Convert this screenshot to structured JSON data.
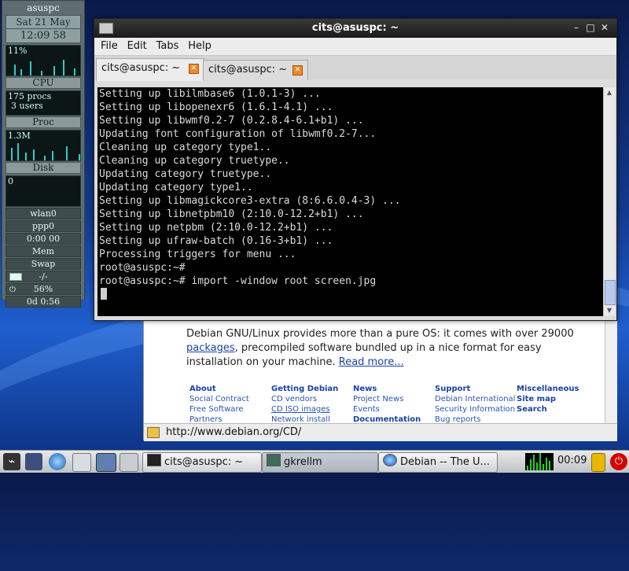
{
  "gkrellm": {
    "hostname": "asuspc",
    "date": "Sat 21 May",
    "time": "12:09 58",
    "cpu_percent_label": "11%",
    "cpu_label": "CPU",
    "procs": "175 procs",
    "users": "3 users",
    "proc_label": "Proc",
    "disk_rate": "1.3M",
    "disk_label": "Disk",
    "net_value": "0",
    "wlan_label": "wlan0",
    "ppp_label": "ppp0",
    "ppp_timer": "0:00 00",
    "mem_label": "Mem",
    "swap_label": "Swap",
    "mail_value": "-/-",
    "battery_value": "56%",
    "uptime": "0d 0:56"
  },
  "terminal": {
    "title": "cits@asuspc: ~",
    "menu": [
      "File",
      "Edit",
      "Tabs",
      "Help"
    ],
    "tabs": [
      {
        "label": "cits@asuspc: ~",
        "active": true
      },
      {
        "label": "cits@asuspc: ~",
        "active": false
      }
    ],
    "lines": [
      "Setting up libilmbase6 (1.0.1-3) ...",
      "Setting up libopenexr6 (1.6.1-4.1) ...",
      "Setting up libwmf0.2-7 (0.2.8.4-6.1+b1) ...",
      "Updating font configuration of libwmf0.2-7...",
      "Cleaning up category type1..",
      "Cleaning up category truetype..",
      "Updating category truetype..",
      "Updating category type1..",
      "Setting up libmagickcore3-extra (8:6.6.0.4-3) ...",
      "Setting up libnetpbm10 (2:10.0-12.2+b1) ...",
      "Setting up netpbm (2:10.0-12.2+b1) ...",
      "Setting up ufraw-batch (0.16-3+b1) ...",
      "Processing triggers for menu ...",
      "root@asuspc:~#",
      "root@asuspc:~# import -window root screen.jpg"
    ]
  },
  "browser": {
    "intro_before_link": "Debian GNU/Linux provides more than a pure OS: it comes with over 29000",
    "intro_link": "packages",
    "intro_after_link": ", precompiled software bundled up in a nice format for easy installation on your machine.",
    "read_more": "Read more...",
    "columns": [
      {
        "heading": "About",
        "items": [
          "Social Contract",
          "Free Software",
          "Partners"
        ]
      },
      {
        "heading": "Getting Debian",
        "items": [
          "CD vendors",
          "CD ISO images",
          "Network install"
        ]
      },
      {
        "heading": "News",
        "items": [
          "Project News",
          "Events",
          "Documentation"
        ]
      },
      {
        "heading": "Support",
        "items": [
          "Debian International",
          "Security Information",
          "Bug reports"
        ]
      },
      {
        "heading": "Miscellaneous",
        "items": [
          "Site map",
          "Search"
        ]
      }
    ],
    "status_url": "http://www.debian.org/CD/"
  },
  "taskbar": {
    "tasks": [
      {
        "label": "cits@asuspc: ~",
        "active": false
      },
      {
        "label": "gkrellm",
        "active": true
      },
      {
        "label": "Debian -- The U...",
        "active": false
      }
    ],
    "clock": "00:09"
  }
}
